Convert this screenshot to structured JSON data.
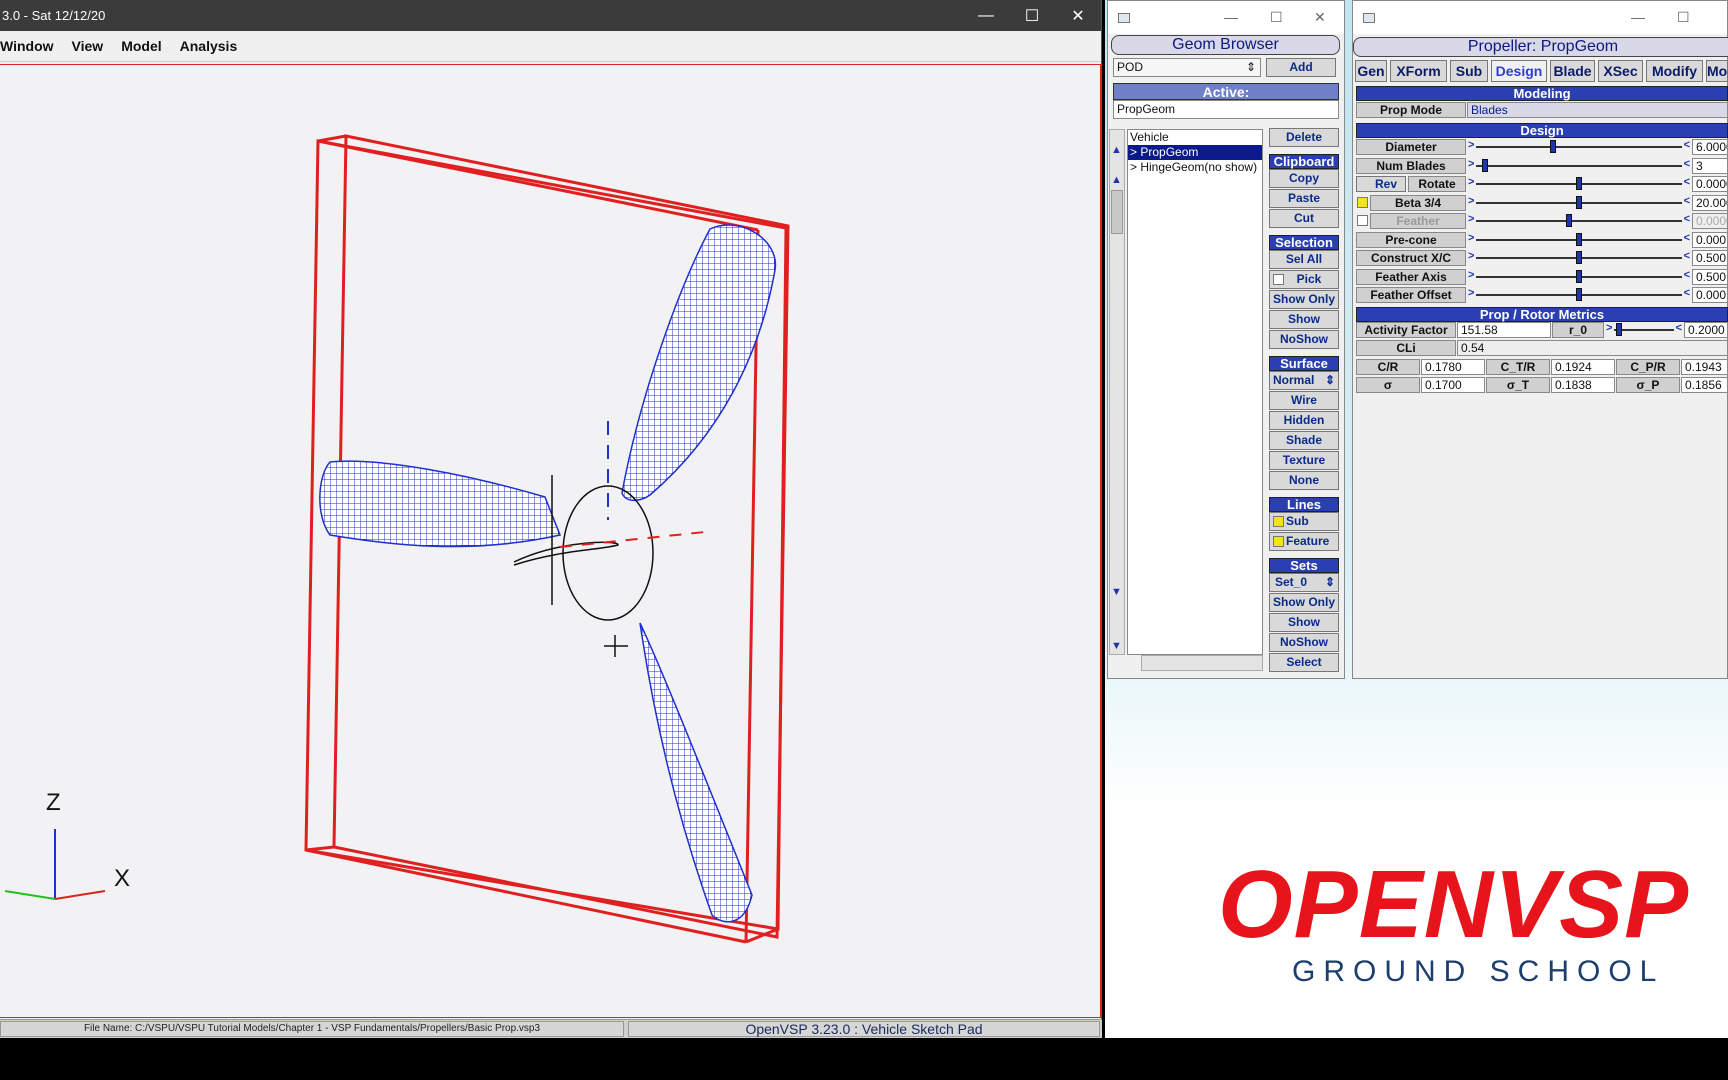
{
  "main_window": {
    "title": "3.0 - Sat 12/12/20",
    "controls": {
      "minimize": "—",
      "maximize": "☐",
      "close": "✕"
    },
    "menu": [
      "Window",
      "View",
      "Model",
      "Analysis"
    ],
    "axes": {
      "z": "Z",
      "x": "X"
    },
    "status_file": "File Name: C:/VSPU/VSPU Tutorial Models/Chapter 1 - VSP Fundamentals/Propellers/Basic Prop.vsp3",
    "status_app": "OpenVSP 3.23.0 : Vehicle Sketch Pad",
    "colors": {
      "frame": "#e02020",
      "blades": "#1f2fd0"
    }
  },
  "geom_browser": {
    "title": "Geom Browser",
    "type_select": "POD",
    "add_label": "Add",
    "active_label": "Active:",
    "active_value": "PropGeom",
    "tree": [
      "Vehicle",
      "> PropGeom",
      "> HingeGeom(no show)"
    ],
    "delete": "Delete",
    "clipboard": {
      "header": "Clipboard",
      "copy": "Copy",
      "paste": "Paste",
      "cut": "Cut"
    },
    "selection": {
      "header": "Selection",
      "sel_all": "Sel All",
      "pick": "Pick",
      "show_only": "Show Only",
      "show": "Show",
      "noshow": "NoShow"
    },
    "surface": {
      "header": "Surface",
      "normal": "Normal",
      "wire": "Wire",
      "hidden": "Hidden",
      "shade": "Shade",
      "texture": "Texture",
      "none": "None"
    },
    "lines": {
      "header": "Lines",
      "sub": "Sub",
      "feature": "Feature"
    },
    "sets": {
      "header": "Sets",
      "set": "Set_0",
      "show_only": "Show Only",
      "show": "Show",
      "noshow": "NoShow",
      "select": "Select"
    }
  },
  "propeller": {
    "title": "Propeller: PropGeom",
    "tabs": [
      "Gen",
      "XForm",
      "Sub",
      "Design",
      "Blade",
      "XSec",
      "Modify",
      "Mo"
    ],
    "active_tab": "Design",
    "modeling_header": "Modeling",
    "prop_mode_label": "Prop Mode",
    "prop_mode_value": "Blades",
    "design_header": "Design",
    "params": [
      {
        "label": "Diameter",
        "value": "6.0000",
        "pos": 0.37
      },
      {
        "label": "Num Blades",
        "value": "3",
        "pos": 0.03
      },
      {
        "label": "Rotate",
        "value": "0.0000",
        "pos": 0.5
      },
      {
        "label": "Beta 3/4",
        "value": "20.0000",
        "pos": 0.5
      },
      {
        "label": "Feather",
        "value": "0.0000",
        "pos": 0.45
      },
      {
        "label": "Pre-cone",
        "value": "0.000",
        "pos": 0.5
      },
      {
        "label": "Construct X/C",
        "value": "0.500",
        "pos": 0.5
      },
      {
        "label": "Feather Axis",
        "value": "0.500",
        "pos": 0.5
      },
      {
        "label": "Feather Offset",
        "value": "0.000",
        "pos": 0.5
      }
    ],
    "rev_label": "Rev",
    "metrics_header": "Prop / Rotor Metrics",
    "activity_factor_label": "Activity Factor",
    "activity_factor": "151.58",
    "r0_label": "r_0",
    "r0_value": "0.2000",
    "cli_label": "CLi",
    "cli_value": "0.54",
    "metrics_row1": [
      {
        "label": "C/R",
        "value": "0.1780"
      },
      {
        "label": "C_T/R",
        "value": "0.1924"
      },
      {
        "label": "C_P/R",
        "value": "0.1943"
      }
    ],
    "metrics_row2": [
      {
        "label": "σ",
        "value": "0.1700"
      },
      {
        "label": "σ_T",
        "value": "0.1838"
      },
      {
        "label": "σ_P",
        "value": "0.1856"
      }
    ]
  },
  "logo": {
    "main": "OPENVSP",
    "sub": "GROUND SCHOOL"
  }
}
